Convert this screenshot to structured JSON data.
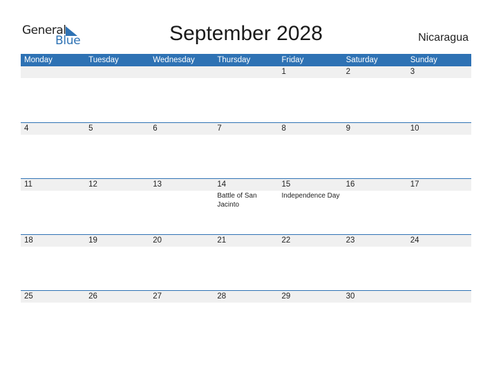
{
  "logo": {
    "general": "General",
    "blue": "Blue"
  },
  "title": "September 2028",
  "country": "Nicaragua",
  "colors": {
    "accent": "#2e72b4",
    "date_strip": "#f0f0f0"
  },
  "weekdays": [
    "Monday",
    "Tuesday",
    "Wednesday",
    "Thursday",
    "Friday",
    "Saturday",
    "Sunday"
  ],
  "weeks": [
    {
      "days": [
        "",
        "",
        "",
        "",
        "1",
        "2",
        "3"
      ],
      "events": [
        "",
        "",
        "",
        "",
        "",
        "",
        ""
      ]
    },
    {
      "days": [
        "4",
        "5",
        "6",
        "7",
        "8",
        "9",
        "10"
      ],
      "events": [
        "",
        "",
        "",
        "",
        "",
        "",
        ""
      ]
    },
    {
      "days": [
        "11",
        "12",
        "13",
        "14",
        "15",
        "16",
        "17"
      ],
      "events": [
        "",
        "",
        "",
        "Battle of San Jacinto",
        "Independence Day",
        "",
        ""
      ]
    },
    {
      "days": [
        "18",
        "19",
        "20",
        "21",
        "22",
        "23",
        "24"
      ],
      "events": [
        "",
        "",
        "",
        "",
        "",
        "",
        ""
      ]
    },
    {
      "days": [
        "25",
        "26",
        "27",
        "28",
        "29",
        "30",
        ""
      ],
      "events": [
        "",
        "",
        "",
        "",
        "",
        "",
        ""
      ]
    }
  ]
}
